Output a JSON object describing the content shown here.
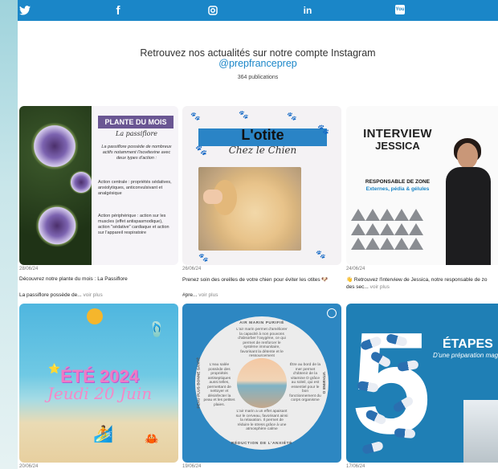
{
  "social": {
    "items": [
      {
        "name": "twitter",
        "glyph": "🐦"
      },
      {
        "name": "facebook",
        "glyph": "f"
      },
      {
        "name": "instagram",
        "glyph": "◎"
      },
      {
        "name": "linkedin",
        "glyph": "in"
      },
      {
        "name": "youtube",
        "glyph": "You"
      }
    ],
    "bar_color": "#1a86c8"
  },
  "instagram": {
    "title": "Retrouvez nos actualités sur notre compte Instagram",
    "handle": "@prepfranceprep",
    "count": "364 publications"
  },
  "posts": [
    {
      "date": "28/06/24",
      "caption_line1": "Découvrez notre plante du mois : La Passiflore",
      "caption_line2": "La passiflore possède de...",
      "more": "voir plus",
      "card": {
        "tag": "PLANTE DU MOIS",
        "subtitle": "La passiflore",
        "intro": "La passiflore possède de nombreux actifs notamment l'isovitexine avec deux types d'action :",
        "bullet1": "Action centrale : propriétés sédatives, anxiolytiques, anticonvulsivant et analgésique",
        "bullet2": "Action périphérique : action sur les muscles (effet antispasmodique), action \"sédative\" cardiaque et action sur l'appareil respiratoire"
      }
    },
    {
      "date": "26/06/24",
      "caption_line1": "Prenez soin des oreilles de votre chien pour éviter les otites 🐶",
      "caption_line2": "#pre...",
      "more": "voir plus",
      "card": {
        "title": "L'otite",
        "subtitle": "Chez le Chien"
      }
    },
    {
      "date": "24/06/24",
      "caption_line1": "👋 Retrouvez l'interview de Jessica, notre responsable de zo",
      "caption_line2": "des sec...",
      "more": "voir plus",
      "card": {
        "title": "INTERVIEW",
        "name": "JESSICA",
        "role": "RESPONSABLE DE ZONE",
        "role2": "Externes, pédia & gélules"
      }
    },
    {
      "date": "20/06/24",
      "card": {
        "title": "ÉTÉ 2024",
        "subtitle": "Jeudi 20 Juin"
      }
    },
    {
      "date": "19/06/24",
      "card": {
        "top_label": "AIR MARIN PURIFIÉ",
        "bottom_label": "RÉDUCTION DE L'ANXIÉTÉ",
        "left_label": "PEAU PLUS BONNE SANTÉ",
        "right_label": "VITAMINE D",
        "p_top": "L'air marin permet d'améliorer la capacité à non pouvons d'absorber l'oxygène, ce qui permet de renforcer le système immunitaire, favorisant la détente et le ressourcement",
        "p_left": "L'eau salée possède des propriétés antiseptiques aussi telles, permettant de nettoyer et désinfecter la peau et les petites plaies.",
        "p_right": "Être au bord de la mer permet d'obtenir de la vitamine D grâce au soleil, qui est essentiel pour le bon fonctionnement du corps organisme",
        "p_bottom": "L'air marin a un effet apaisant sur le cerveau, favorisant ainsi la relaxation. Il permet de réduire le stress grâce à une atmosphère calme"
      }
    },
    {
      "date": "17/06/24",
      "card": {
        "number": "5",
        "title": "ÉTAPES",
        "desc": "D'une préparation magistral"
      }
    }
  ]
}
